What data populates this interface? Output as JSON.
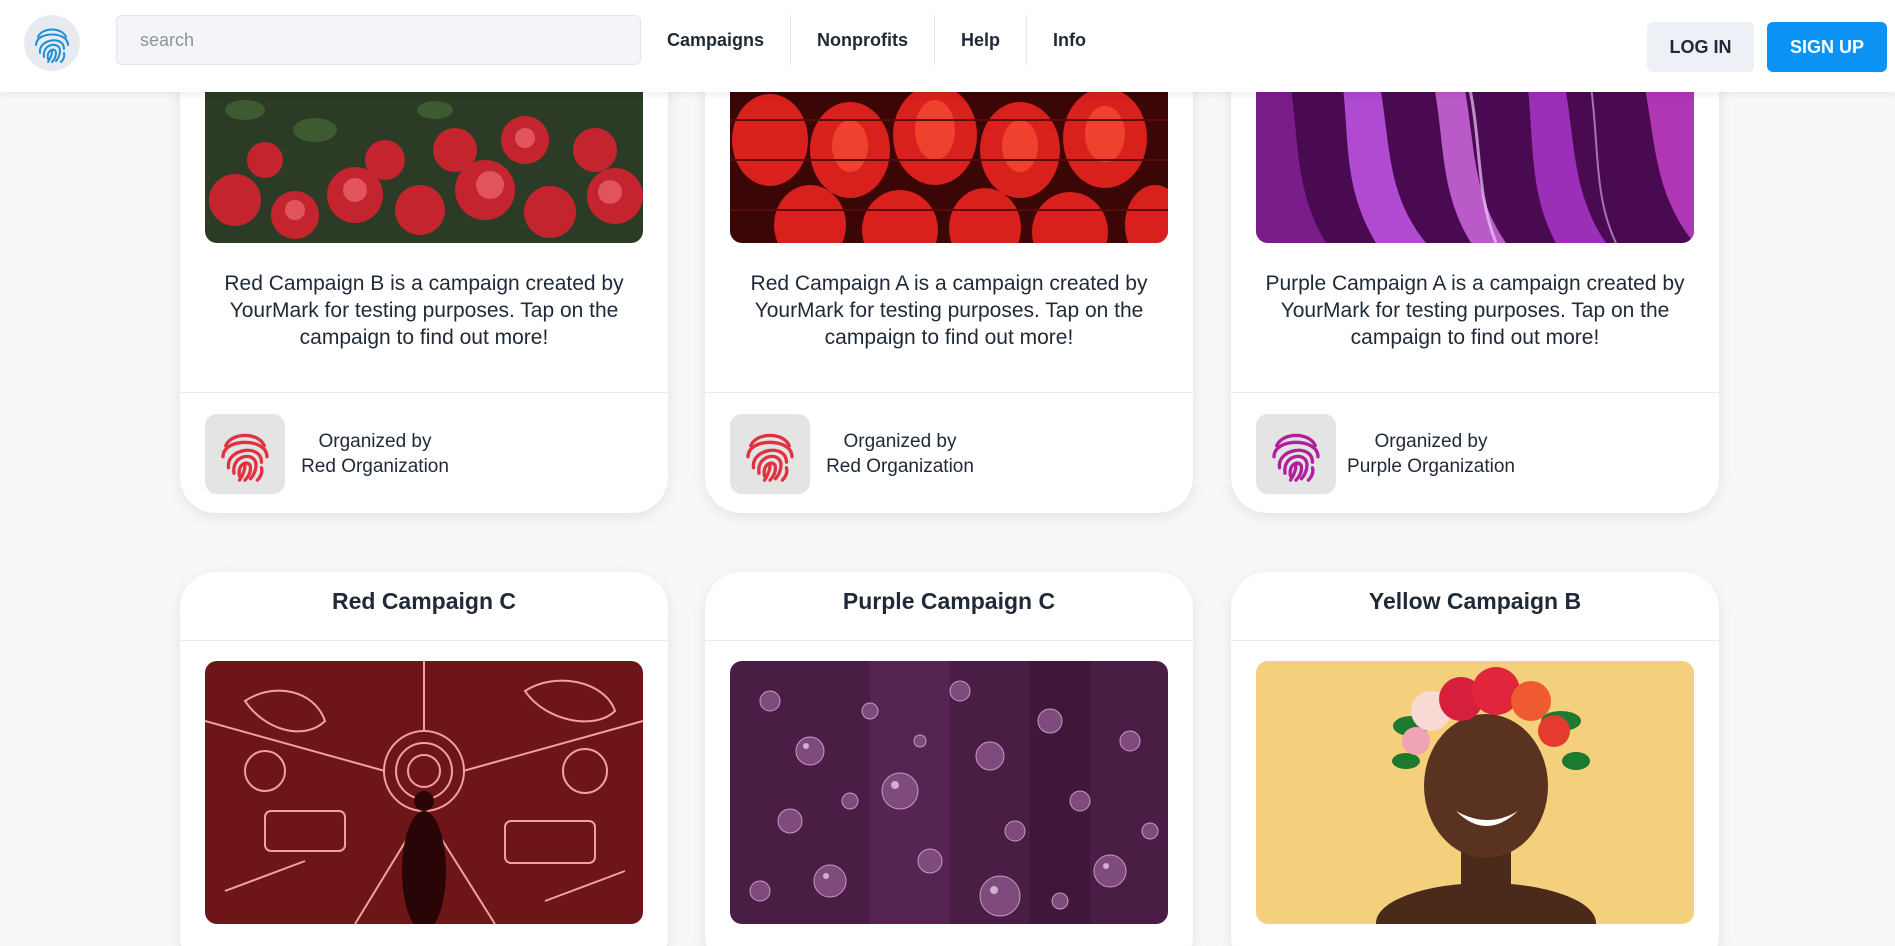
{
  "header": {
    "search_placeholder": "search",
    "nav": [
      "Campaigns",
      "Nonprofits",
      "Help",
      "Info"
    ],
    "login_label": "LOG IN",
    "signup_label": "SIGN UP"
  },
  "colors": {
    "accent": "#0b93f6",
    "red_org": "#e0323f",
    "purple_org": "#b0209a"
  },
  "campaigns_top": [
    {
      "description": "Red Campaign B is a campaign created by YourMark for testing purposes. Tap on the campaign to find out more!",
      "organized_by": "Organized by",
      "org_name": "Red Organization",
      "org_color": "red",
      "image": "red-flowers"
    },
    {
      "description": "Red Campaign A is a campaign created by YourMark for testing purposes. Tap on the campaign to find out more!",
      "organized_by": "Organized by",
      "org_name": "Red Organization",
      "org_color": "red",
      "image": "red-lanterns"
    },
    {
      "description": "Purple Campaign A is a campaign created by YourMark for testing purposes. Tap on the campaign to find out more!",
      "organized_by": "Organized by",
      "org_name": "Purple Organization",
      "org_color": "purple",
      "image": "purple-swirl"
    }
  ],
  "campaigns_bottom": [
    {
      "title": "Red Campaign C",
      "image": "red-neon-instruments"
    },
    {
      "title": "Purple Campaign C",
      "image": "purple-bubbles"
    },
    {
      "title": "Yellow Campaign B",
      "image": "woman-flower-crown"
    }
  ]
}
